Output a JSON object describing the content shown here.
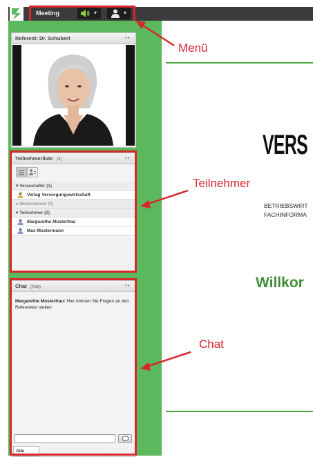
{
  "menu": {
    "meeting_label": "Meeting",
    "speaker_icon": "speaker-icon",
    "user_icon": "user-icon"
  },
  "speaker_panel": {
    "title": "Referent: Dr. Schubert"
  },
  "participants": {
    "title": "Teilnehmerliste",
    "count": "(3)",
    "groups": {
      "organizers": "Veranstalter (1)",
      "organizer_name": "Verlag Versorgungswirtschaft",
      "moderators": "Moderatoren (0)",
      "participants": "Teilnehmer (2)",
      "participant_1": "Margarethe Musterfrau",
      "participant_2": "Max Mustermann"
    }
  },
  "chat": {
    "title": "Chat",
    "scope": "(Alle)",
    "message_sender": "Margarethe Musterfrau:",
    "message_text": "Hier können Sie Fragen an den Referenten stellen",
    "input_value": "",
    "tab_label": "Alle"
  },
  "slide": {
    "title": "VERS",
    "subtitle_line1": "BETRIEBSWIRT",
    "subtitle_line2": "FACHINFORMA",
    "welcome": "Willkor"
  },
  "annotations": {
    "menu": "Menü",
    "participants": "Teilnehmer",
    "chat": "Chat"
  },
  "colors": {
    "accent_green": "#5cb85c",
    "annotation_red": "#d8262d",
    "toolbar_dark": "#3b3b3b"
  }
}
